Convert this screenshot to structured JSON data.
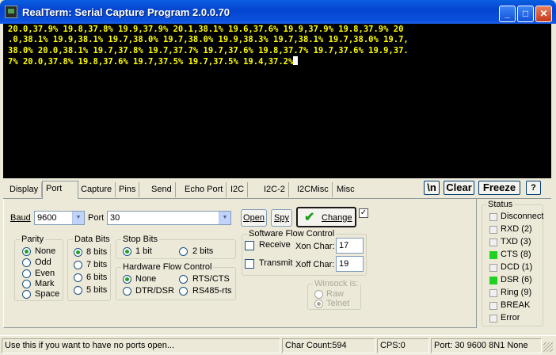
{
  "window": {
    "title": "RealTerm: Serial Capture Program 2.0.0.70"
  },
  "terminal": {
    "lines": [
      "20.0,37.9% 19.8,37.8% 19.9,37.9% 20.1,38.1% 19.6,37.6% 19.9,37.9% 19.8,37.9% 20",
      ".0,38.1% 19.9,38.1% 19.7,38.0% 19.7,38.0% 19.9,38.3% 19.7,38.1% 19.7,38.0% 19.7,",
      "38.0% 20.0,38.1% 19.7,37.8% 19.7,37.7% 19.7,37.6% 19.8,37.7% 19.7,37.6% 19.9,37.",
      "7% 20.0,37.8% 19.8,37.6% 19.7,37.5% 19.7,37.5% 19.4,37.2%"
    ],
    "text_color": "#ffff00",
    "background": "#000000"
  },
  "tabs": [
    "Display",
    "Port",
    "Capture",
    "Pins",
    "Send",
    "Echo Port",
    "I2C",
    "I2C-2",
    "I2CMisc",
    "Misc"
  ],
  "active_tab": "Port",
  "right_buttons": {
    "newline": "\\n",
    "clear": "Clear",
    "freeze": "Freeze",
    "help": "?"
  },
  "port": {
    "baud_label": "Baud",
    "baud_value": "9600",
    "port_label": "Port",
    "port_value": "30",
    "open_label": "Open",
    "spy_label": "Spy",
    "change_label": "Change",
    "change_checked": true
  },
  "parity": {
    "title": "Parity",
    "options": [
      "None",
      "Odd",
      "Even",
      "Mark",
      "Space"
    ],
    "selected": "None"
  },
  "data_bits": {
    "title": "Data Bits",
    "options": [
      "8 bits",
      "7 bits",
      "6 bits",
      "5 bits"
    ],
    "selected": "8 bits"
  },
  "stop_bits": {
    "title": "Stop Bits",
    "options": [
      "1 bit",
      "2 bits"
    ],
    "selected": "1 bit"
  },
  "hardware_flow": {
    "title": "Hardware Flow Control",
    "options": [
      "None",
      "RTS/CTS",
      "DTR/DSR",
      "RS485-rts"
    ],
    "selected": "None"
  },
  "software_flow": {
    "title": "Software Flow Control",
    "receive_label": "Receive",
    "transmit_label": "Transmit",
    "xon_label": "Xon Char:",
    "xon_value": "17",
    "xoff_label": "Xoff Char:",
    "xoff_value": "19"
  },
  "winsock": {
    "title": "Winsock is:",
    "options": [
      "Raw",
      "Telnet"
    ],
    "selected": "Telnet"
  },
  "status": {
    "title": "Status",
    "items": [
      {
        "label": "Disconnect",
        "on": false
      },
      {
        "label": "RXD (2)",
        "on": false
      },
      {
        "label": "TXD (3)",
        "on": false
      },
      {
        "label": "CTS (8)",
        "on": true
      },
      {
        "label": "DCD (1)",
        "on": false
      },
      {
        "label": "DSR (6)",
        "on": true
      },
      {
        "label": "Ring (9)",
        "on": false
      },
      {
        "label": "BREAK",
        "on": false
      },
      {
        "label": "Error",
        "on": false
      }
    ],
    "on_color": "#22d022"
  },
  "statusbar": {
    "hint": "Use this if you want to have no ports open...",
    "char_count": "Char Count:594",
    "cps": "CPS:0",
    "port_info": "Port: 30 9600 8N1 None"
  }
}
